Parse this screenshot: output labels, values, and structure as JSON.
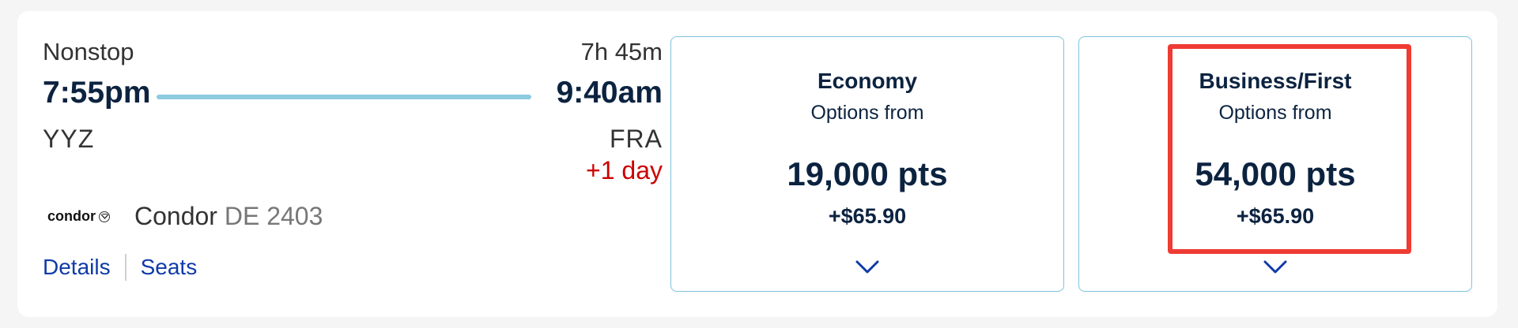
{
  "flight": {
    "stops": "Nonstop",
    "duration": "7h 45m",
    "departure_time": "7:55pm",
    "arrival_time": "9:40am",
    "origin": "YYZ",
    "destination": "FRA",
    "day_offset": "+1 day",
    "airline_logo": "condor",
    "airline_name": "Condor",
    "flight_number": "DE 2403"
  },
  "links": {
    "details": "Details",
    "seats": "Seats"
  },
  "fares": [
    {
      "cabin": "Economy",
      "options_label": "Options from",
      "points": "19,000 pts",
      "cash": "+$65.90",
      "icon": "chevron-down-icon"
    },
    {
      "cabin": "Business/First",
      "options_label": "Options from",
      "points": "54,000 pts",
      "cash": "+$65.90",
      "icon": "chevron-down-icon"
    }
  ],
  "colors": {
    "text_dark": "#0c2340",
    "link": "#0f3aa8",
    "day_offset": "#cc0000",
    "route_line": "#8dcbe0",
    "fare_border": "#7ec3dc",
    "highlight": "#ee3b33"
  }
}
